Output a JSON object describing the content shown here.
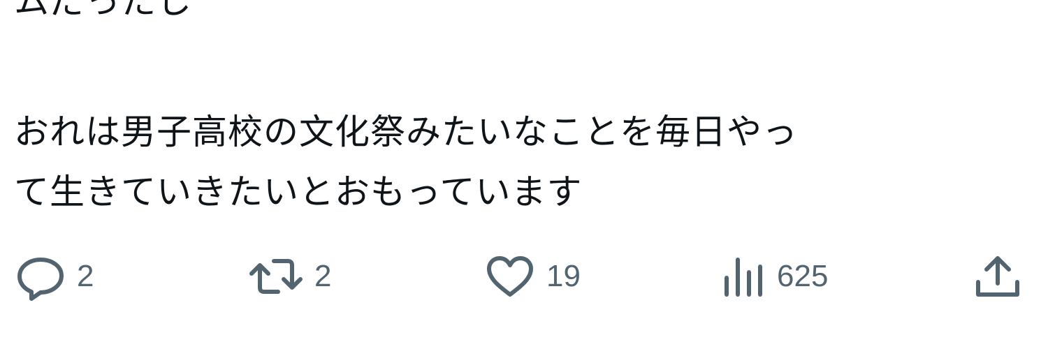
{
  "tweet": {
    "text_partial_top": "ムだったし",
    "text_line_1": "おれは男子高校の文化祭みたいなことを毎日やっ",
    "text_line_2": "て生きていきたいとおもっています"
  },
  "actions": {
    "reply_count": "2",
    "retweet_count": "2",
    "like_count": "19",
    "view_count": "625"
  },
  "icons": {
    "reply": "speech-bubble-icon",
    "retweet": "retweet-icon",
    "like": "heart-icon",
    "views": "bar-chart-icon",
    "share": "share-upload-icon"
  },
  "colors": {
    "text": "#0f1419",
    "icon": "#536471",
    "background": "#ffffff"
  }
}
